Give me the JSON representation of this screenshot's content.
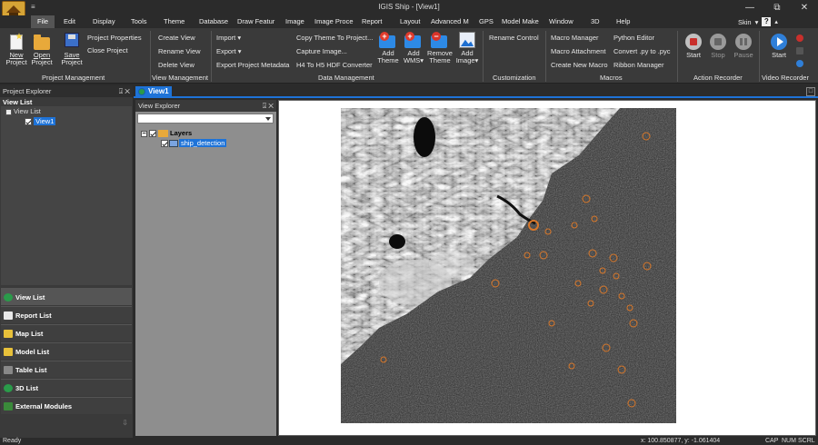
{
  "window": {
    "title": "IGIS Ship - [View1]",
    "qat_arrow": "≡",
    "minimize": "—",
    "restore": "⧉",
    "close": "✕"
  },
  "menu": {
    "items": [
      "File",
      "Edit",
      "Display",
      "Tools",
      "Theme",
      "Database",
      "Draw Featur",
      "Image",
      "Image Proce",
      "Report",
      "Layout",
      "Advanced M",
      "GPS",
      "Model Make",
      "Window",
      "3D",
      "Help"
    ],
    "skin_label": "Skin",
    "help_glyph": "?"
  },
  "ribbon": {
    "project": {
      "new_1": "New",
      "new_2": "Project",
      "open_1": "Open",
      "open_2": "Project",
      "save_1": "Save",
      "save_2": "Project",
      "properties": "Project Properties",
      "close": "Close Project",
      "group": "Project Management"
    },
    "view": {
      "create": "Create View",
      "rename": "Rename View",
      "delete": "Delete View",
      "group": "View Management"
    },
    "data": {
      "import": "Import",
      "export": "Export",
      "export_meta": "Export Project Metadata",
      "copy_theme": "Copy Theme To Project...",
      "capture": "Capture Image...",
      "h4h5": "H4 To H5 HDF Converter",
      "add_theme_1": "Add",
      "add_theme_2": "Theme",
      "add_wms_1": "Add",
      "add_wms_2": "WMS",
      "remove_theme_1": "Remove",
      "remove_theme_2": "Theme",
      "add_image_1": "Add",
      "add_image_2": "Image",
      "group": "Data Management"
    },
    "custom": {
      "rename_control": "Rename Control",
      "group": "Customization"
    },
    "macros": {
      "manager": "Macro Manager",
      "attachment": "Macro Attachment",
      "create": "Create New Macro",
      "python": "Python Editor",
      "convert": "Convert .py to .pyc",
      "ribbon_mgr": "Ribbon Manager",
      "group": "Macros"
    },
    "action": {
      "start": "Start",
      "stop": "Stop",
      "pause": "Pause",
      "group": "Action Recorder"
    },
    "video": {
      "start": "Start",
      "group": "Video Recorder"
    }
  },
  "project_explorer": {
    "title": "Project Explorer",
    "pin": "⍗ ✕",
    "list_header": "View List",
    "tree_root": "View List",
    "tree_child": "View1",
    "nav": [
      "View List",
      "Report List",
      "Map List",
      "Model List",
      "Table List",
      "3D List",
      "External Modules"
    ],
    "grip": "⇩"
  },
  "doc_tab": {
    "label": "View1",
    "menu_glyph": "□"
  },
  "view_explorer": {
    "title": "View Explorer",
    "pin": "⍗ ✕",
    "layers": "Layers",
    "layer_item": "ship_detection"
  },
  "status": {
    "ready": "Ready",
    "coords": "x: 100.850877,  y: -1.061404",
    "cap": "CAP",
    "num": "NUM",
    "scrl": "SCRL"
  },
  "colors": {
    "accent": "#1e73d8",
    "detection_ring": "#d9782a"
  },
  "icons": [
    "new-project-icon",
    "open-folder-icon",
    "save-icon",
    "add-theme-icon",
    "add-wms-icon",
    "remove-theme-icon",
    "add-image-icon",
    "record-icon",
    "stop-icon",
    "pause-icon",
    "play-icon",
    "globe-icon"
  ]
}
